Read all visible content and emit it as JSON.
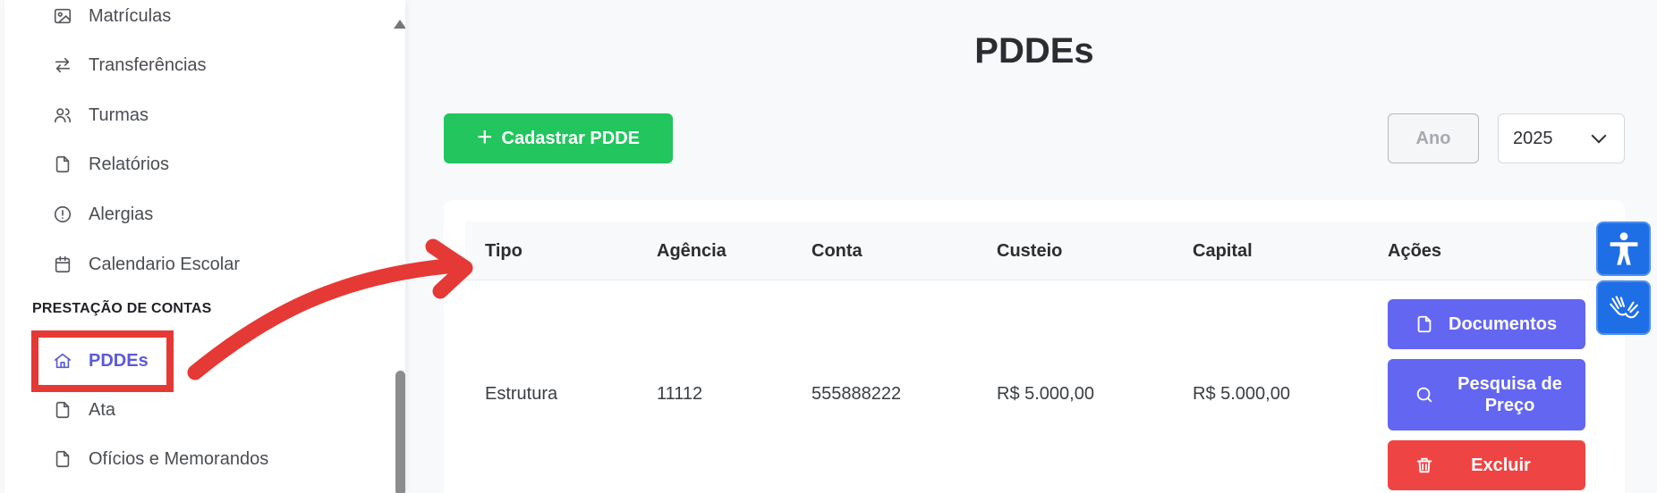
{
  "sidebar": {
    "items": [
      {
        "label": "Matrículas",
        "icon": "image-icon"
      },
      {
        "label": "Transferências",
        "icon": "transfer-arrows-icon"
      },
      {
        "label": "Turmas",
        "icon": "users-icon"
      },
      {
        "label": "Relatórios",
        "icon": "file-icon"
      },
      {
        "label": "Alergias",
        "icon": "alert-circle-icon"
      },
      {
        "label": "Calendario Escolar",
        "icon": "calendar-icon"
      }
    ],
    "section_title": "PRESTAÇÃO DE CONTAS",
    "section_items": [
      {
        "label": "PDDEs",
        "icon": "home-icon",
        "active": true
      },
      {
        "label": "Ata",
        "icon": "file-icon"
      },
      {
        "label": "Ofícios e Memorandos",
        "icon": "file-icon"
      }
    ]
  },
  "main": {
    "title": "PDDEs",
    "new_button": "Cadastrar PDDE",
    "year_label": "Ano",
    "year_value": "2025",
    "table": {
      "headers": [
        "Tipo",
        "Agência",
        "Conta",
        "Custeio",
        "Capital",
        "Ações"
      ],
      "rows": [
        {
          "tipo": "Estrutura",
          "agencia": "11112",
          "conta": "555888222",
          "custeio": "R$ 5.000,00",
          "capital": "R$ 5.000,00"
        }
      ],
      "actions": {
        "documentos": "Documentos",
        "pesquisa_line1": "Pesquisa de",
        "pesquisa_line2": "Preço",
        "excluir": "Excluir"
      }
    }
  },
  "colors": {
    "primary": "#6366f1",
    "success": "#22c55e",
    "danger": "#ef4444",
    "annotation": "#e53935",
    "accessibility": "#1e6ee6"
  }
}
